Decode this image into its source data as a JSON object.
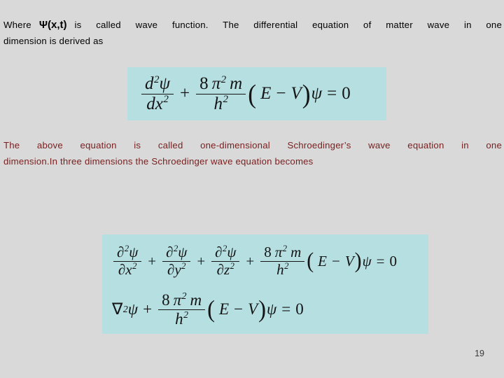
{
  "slide": {
    "background_color": "#d9d9d9",
    "page_number": "19"
  },
  "intro_paragraph": {
    "color": "#000000",
    "line1_before": "Where",
    "wave_function_symbol": "Ψ(x,t)",
    "line1_after": "is called wave function. The differential equation of matter wave in one",
    "line2": "dimension is derived as"
  },
  "equation_1d": {
    "background_color": "#b6dfe2",
    "description": "one-dimensional Schroedinger wave equation",
    "latex": "d^2\\psi/dx^2 + (8\\pi^2 m/h^2)(E - V)\\psi = 0",
    "num_left": "d",
    "num_left_exp": "2",
    "num_left_psi": "ψ",
    "den_left": "dx",
    "den_left_exp": "2",
    "plus": "+",
    "coef_num_8": "8",
    "coef_num_pi": "π",
    "coef_num_pi_exp": "2",
    "coef_num_m": "m",
    "coef_den_h": "h",
    "coef_den_exp": "2",
    "paren_open": "(",
    "E": "E",
    "minus": "−",
    "V": "V",
    "paren_close": ")",
    "psi": "ψ",
    "equals": "=",
    "zero": "0"
  },
  "middle_paragraph": {
    "color": "#7a2020",
    "line1": "The above equation is called one-dimensional Schroedinger’s wave equation in one",
    "line2": "dimension.In three dimensions the Schroedinger wave equation becomes"
  },
  "equation_3d": {
    "background_color": "#b6dfe2",
    "description": "three-dimensional Schroedinger wave equation and Laplacian form",
    "line_a_latex": "\\partial^2\\psi/\\partial x^2 + \\partial^2\\psi/\\partial y^2 + \\partial^2\\psi/\\partial z^2 + (8\\pi^2 m/h^2)(E - V)\\psi = 0",
    "line_b_latex": "\\nabla^2\\psi + (8\\pi^2 m/h^2)(E - V)\\psi = 0",
    "partial": "∂",
    "exp2": "2",
    "psi": "ψ",
    "var_x": "x",
    "var_y": "y",
    "var_z": "z",
    "plus": "+",
    "coef_num_8": "8",
    "coef_num_pi": "π",
    "coef_num_m": "m",
    "coef_den_h": "h",
    "paren_open": "(",
    "E": "E",
    "minus": "−",
    "V": "V",
    "paren_close": ")",
    "equals": "=",
    "zero": "0",
    "nabla": "∇"
  }
}
